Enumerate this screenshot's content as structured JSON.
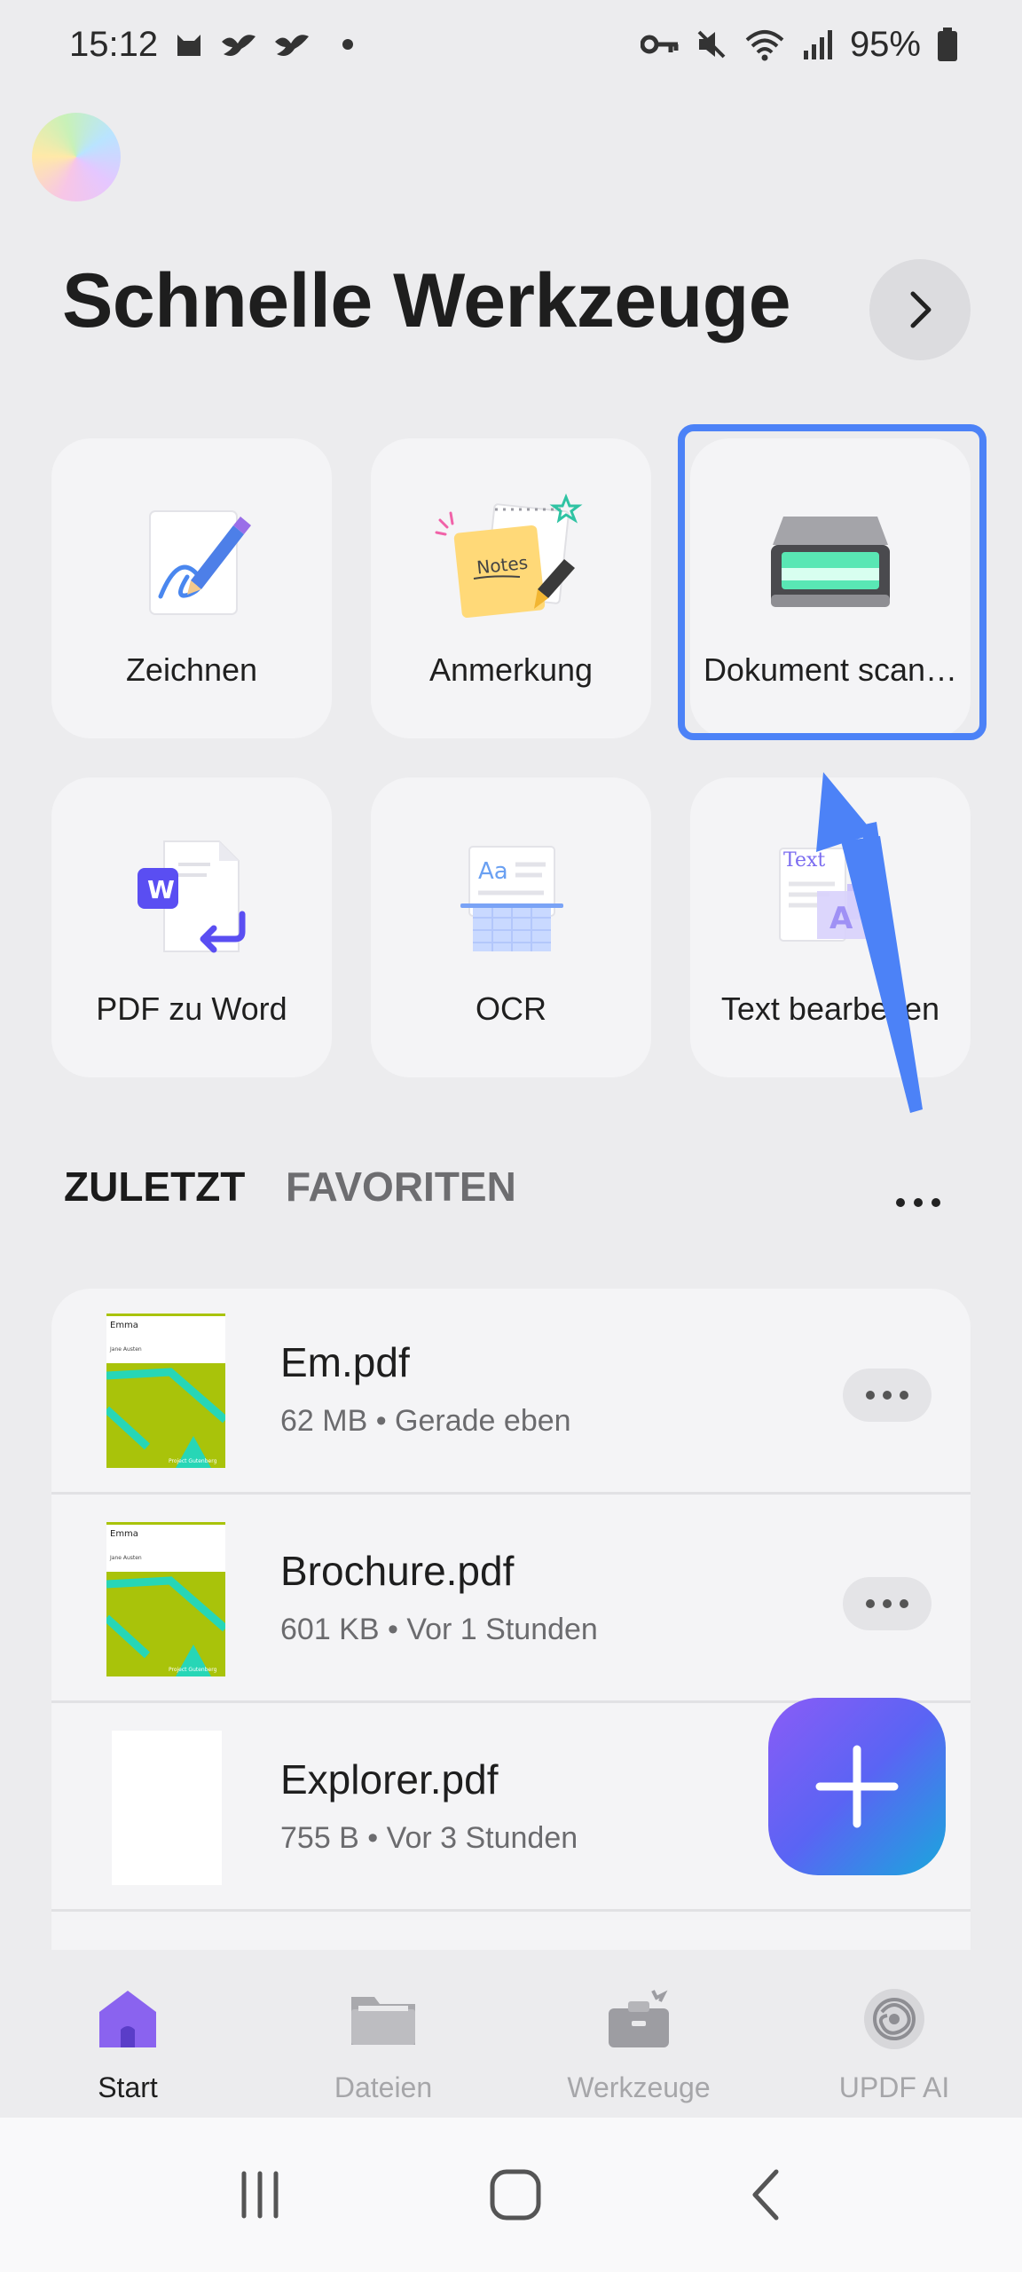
{
  "status_bar": {
    "time": "15:12",
    "battery": "95%"
  },
  "header": {
    "title": "Schnelle Werkzeuge"
  },
  "tools": [
    {
      "label": "Zeichnen",
      "icon": "pen-drawing-icon"
    },
    {
      "label": "Anmerkung",
      "icon": "notes-annotation-icon"
    },
    {
      "label": "Dokument scan…",
      "icon": "scanner-icon"
    },
    {
      "label": "PDF zu Word",
      "icon": "pdf-to-word-icon"
    },
    {
      "label": "OCR",
      "icon": "ocr-icon"
    },
    {
      "label": "Text bearbeiten",
      "icon": "edit-text-icon"
    }
  ],
  "tool_icon_text": {
    "notes": "Notes",
    "word": "W",
    "ocr": "Aa",
    "edit": "Text",
    "edit_a": "A"
  },
  "tabs": {
    "recent": "ZULETZT",
    "favorites": "FAVORITEN"
  },
  "files": [
    {
      "name": "Em.pdf",
      "meta": "62 MB • Gerade eben",
      "thumb_title": "Emma",
      "thumb_author": "Jane Austen",
      "thumb_footer": "Project Gutenberg"
    },
    {
      "name": "Brochure.pdf",
      "meta": "601 KB • Vor 1 Stunden",
      "thumb_title": "Emma",
      "thumb_author": "Jane Austen",
      "thumb_footer": "Project Gutenberg"
    },
    {
      "name": "Explorer.pdf",
      "meta": "755 B • Vor 3 Stunden"
    }
  ],
  "bottom_nav": [
    {
      "label": "Start",
      "icon": "home-icon",
      "active": true
    },
    {
      "label": "Dateien",
      "icon": "folder-icon",
      "active": false
    },
    {
      "label": "Werkzeuge",
      "icon": "toolbox-icon",
      "active": false
    },
    {
      "label": "UPDF AI",
      "icon": "ai-icon",
      "active": false
    }
  ],
  "colors": {
    "accent": "#4c82f7",
    "fab_start": "#8a5cf6",
    "fab_end": "#1aa7dc",
    "thumb_green": "#a9c30a",
    "thumb_teal": "#27d6b6"
  }
}
